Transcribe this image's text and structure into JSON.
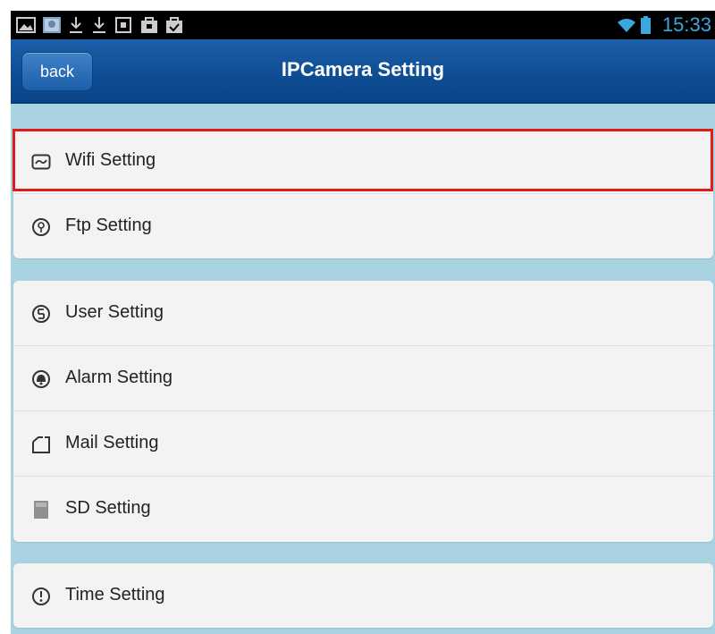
{
  "status_bar": {
    "time": "15:33",
    "icons": [
      "gallery-icon",
      "photo-icon",
      "download-icon",
      "download-icon",
      "camera-icon",
      "bag-icon",
      "bag-check-icon",
      "wifi-icon",
      "battery-icon"
    ]
  },
  "header": {
    "back_label": "back",
    "title": "IPCamera  Setting"
  },
  "settings": {
    "group1": [
      {
        "label": "Wifi Setting",
        "icon": "wifi-setting-icon"
      },
      {
        "label": "Ftp Setting",
        "icon": "ftp-icon"
      }
    ],
    "group2": [
      {
        "label": "User Setting",
        "icon": "user-icon"
      },
      {
        "label": "Alarm Setting",
        "icon": "alarm-icon"
      },
      {
        "label": "Mail Setting",
        "icon": "mail-icon"
      },
      {
        "label": "SD Setting",
        "icon": "sd-card-icon"
      }
    ],
    "group3": [
      {
        "label": "Time Setting",
        "icon": "clock-icon"
      }
    ]
  },
  "colors": {
    "title_bar": "#0f4e94",
    "background": "#a9d3e0",
    "highlight": "#e01b1b",
    "time_text": "#3aa7dd"
  }
}
